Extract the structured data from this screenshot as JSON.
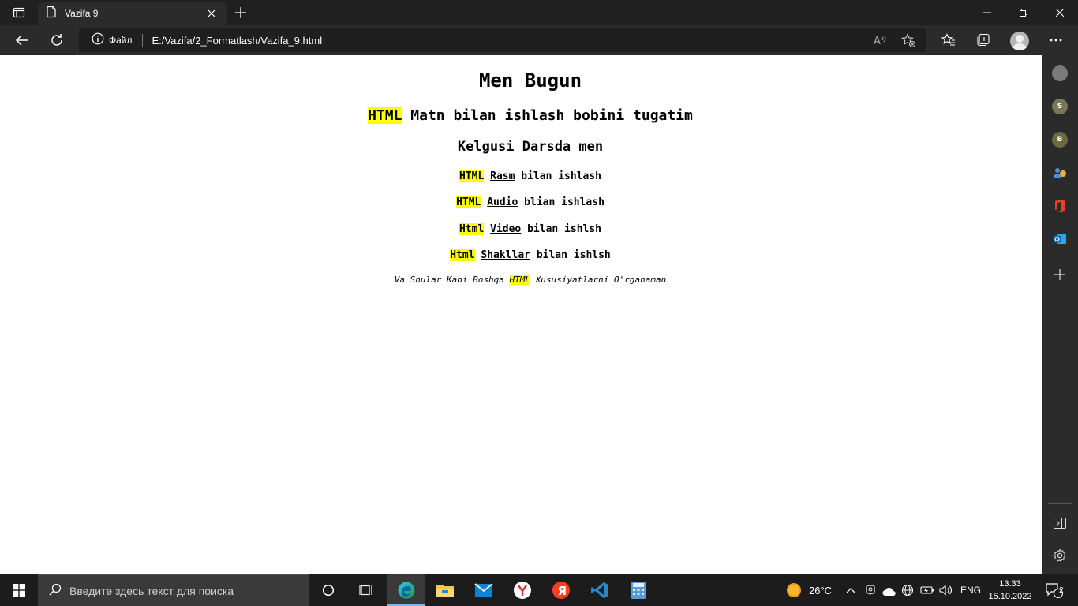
{
  "browser": {
    "tab": {
      "title": "Vazifa 9"
    },
    "address": {
      "security_label": "Файл",
      "url": "E:/Vazifa/2_Formatlash/Vazifa_9.html"
    }
  },
  "page": {
    "h1": "Men Bugun",
    "h2": {
      "highlight": "HTML",
      "rest": " Matn bilan ishlash bobini tugatim"
    },
    "h3": "Kelgusi Darsda men",
    "items": [
      {
        "highlight": "HTML",
        "link": "Rasm",
        "rest": " bilan ishlash"
      },
      {
        "highlight": "HTML",
        "link": "Audio",
        "rest": " blian ishlash"
      },
      {
        "highlight": "Html",
        "link": "Video",
        "rest": " bilan ishlsh"
      },
      {
        "highlight": "Html",
        "link": "Shakllar",
        "rest": " bilan ishlsh"
      }
    ],
    "footer": {
      "before": "Va Shular Kabi Boshqa ",
      "highlight": "HTML",
      "after": " Xususiyatlarni O'rganaman"
    }
  },
  "sidebar": {
    "items": [
      {
        "name": "S"
      },
      {
        "name": "B"
      }
    ]
  },
  "taskbar": {
    "search_placeholder": "Введите здесь текст для поиска",
    "temperature": "26°C",
    "language": "ENG",
    "time": "13:33",
    "date": "15.10.2022",
    "notification_count": "2"
  },
  "colors": {
    "highlight": "#ffff00",
    "chrome_dark": "#202020",
    "toolbar": "#2b2b2b"
  }
}
